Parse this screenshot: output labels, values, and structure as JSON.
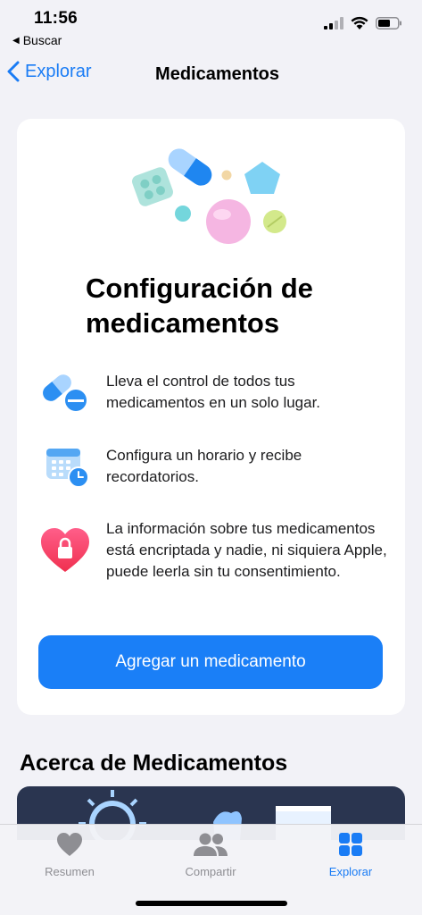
{
  "status_bar": {
    "time": "11:56",
    "back_app_label": "Buscar",
    "icons": [
      "cellular-signal-icon",
      "wifi-icon",
      "battery-icon"
    ]
  },
  "nav": {
    "back_label": "Explorar",
    "title": "Medicamentos"
  },
  "card": {
    "title": "Configuración de medicamentos",
    "illustration": "medication-pills-illustration",
    "features": [
      {
        "icon": "pills-icon",
        "text": "Lleva el control de todos tus medicamentos en un solo lugar."
      },
      {
        "icon": "calendar-clock-icon",
        "text": "Configura un horario y recibe recordatorios."
      },
      {
        "icon": "heart-lock-icon",
        "text": "La información sobre tus medicamentos está encriptada y nadie, ni siquiera Apple, puede leerla sin tu consentimiento."
      }
    ],
    "button_label": "Agregar un medicamento"
  },
  "section": {
    "title": "Acerca de Medicamentos"
  },
  "tabs": [
    {
      "label": "Resumen",
      "icon": "heart-icon",
      "active": false
    },
    {
      "label": "Compartir",
      "icon": "people-icon",
      "active": false
    },
    {
      "label": "Explorar",
      "icon": "grid-icon",
      "active": true
    }
  ],
  "colors": {
    "accent": "#1a7cf5",
    "button": "#1a7ff7",
    "background": "#f2f2f7",
    "inactive_tab": "#8e8e93"
  }
}
